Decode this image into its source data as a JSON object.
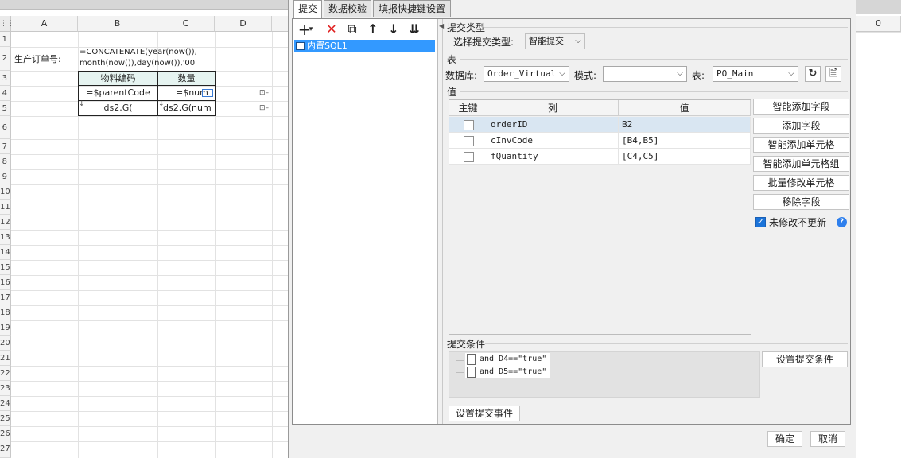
{
  "sheet": {
    "right_value": "0",
    "columns": [
      "A",
      "B",
      "C",
      "D"
    ],
    "rows": [
      "1",
      "2",
      "3",
      "4",
      "5",
      "6",
      "7",
      "8",
      "9",
      "10",
      "11",
      "12",
      "13",
      "14",
      "15",
      "16",
      "17",
      "18",
      "19",
      "20",
      "21",
      "22",
      "23",
      "24",
      "25",
      "26",
      "27"
    ],
    "cells": {
      "a2": "生产订单号:",
      "b2_line1": "=CONCATENATE(year(now()),",
      "b2_line2": "month(now()),day(now()),'00",
      "b3": "物料编码",
      "c3": "数量",
      "b4": "=$parentCode",
      "c4": "=$num",
      "b5": "ds2.G(",
      "c5": "ds2.G(num"
    }
  },
  "dialog": {
    "tabs": [
      "提交",
      "数据校验",
      "填报快捷键设置"
    ],
    "toolbar": {
      "add": "+",
      "add_caret": "▾",
      "delete": "✕",
      "copy": "⧉",
      "up": "↑",
      "down": "↓",
      "bottom": "⇊"
    },
    "tree_item": "内置SQL1",
    "submit_type_section": "提交类型",
    "select_submit_type_label": "选择提交类型:",
    "submit_type_value": "智能提交",
    "table_section": "表",
    "database_label": "数据库:",
    "database_value": "Order_Virtual",
    "schema_label": "模式:",
    "schema_value": "",
    "table_label": "表:",
    "table_value": "PO_Main",
    "value_section": "值",
    "grid": {
      "headers": [
        "主键",
        "列",
        "值"
      ],
      "rows": [
        {
          "column": "orderID",
          "value": "B2"
        },
        {
          "column": "cInvCode",
          "value": "[B4,B5]"
        },
        {
          "column": "fQuantity",
          "value": "[C4,C5]"
        }
      ]
    },
    "side_buttons": [
      "智能添加字段",
      "添加字段",
      "智能添加单元格",
      "智能添加单元格组",
      "批量修改单元格",
      "移除字段"
    ],
    "no_update_unmodified": "未修改不更新",
    "help": "?",
    "submit_condition_section": "提交条件",
    "conditions": [
      "and D4==\"true\"",
      "and D5==\"true\""
    ],
    "set_condition_button": "设置提交条件",
    "set_event_button": "设置提交事件",
    "ok_button": "确定",
    "cancel_button": "取消"
  },
  "colors": {
    "accent": "#3399ff",
    "selected_row": "#d9e6f2",
    "header_cell": "#e6f4f1"
  }
}
